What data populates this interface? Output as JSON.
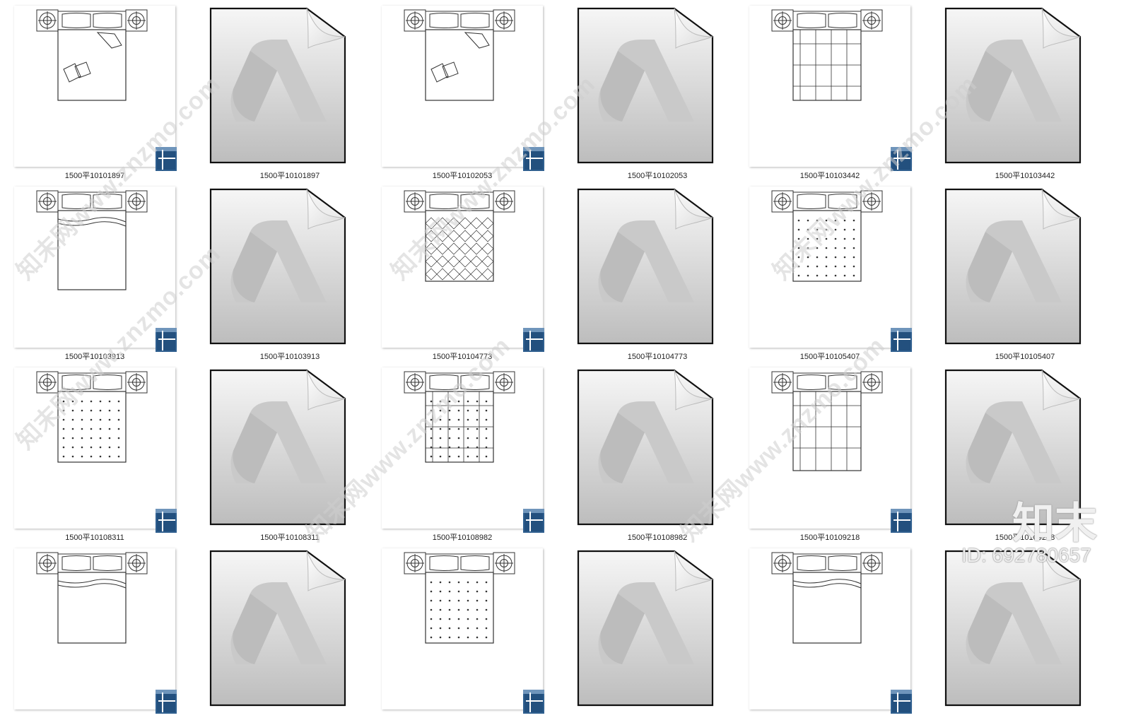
{
  "view": {
    "name": "file-thumbnail-view"
  },
  "rows": [
    {
      "items": [
        {
          "kind": "dwg",
          "label": "1500平10101897",
          "variant": 1
        },
        {
          "kind": "doc",
          "label": "1500平10101897"
        },
        {
          "kind": "dwg",
          "label": "1500平10102053",
          "variant": 2
        },
        {
          "kind": "doc",
          "label": "1500平10102053"
        },
        {
          "kind": "dwg",
          "label": "1500平10103442",
          "variant": 3
        },
        {
          "kind": "doc",
          "label": "1500平10103442"
        }
      ]
    },
    {
      "items": [
        {
          "kind": "dwg",
          "label": "1500平10103913",
          "variant": 4
        },
        {
          "kind": "doc",
          "label": "1500平10103913"
        },
        {
          "kind": "dwg",
          "label": "1500平10104773",
          "variant": 5
        },
        {
          "kind": "doc",
          "label": "1500平10104773"
        },
        {
          "kind": "dwg",
          "label": "1500平10105407",
          "variant": 6
        },
        {
          "kind": "doc",
          "label": "1500平10105407"
        }
      ]
    },
    {
      "items": [
        {
          "kind": "dwg",
          "label": "1500平10108311",
          "variant": 7
        },
        {
          "kind": "doc",
          "label": "1500平10108311"
        },
        {
          "kind": "dwg",
          "label": "1500平10108982",
          "variant": 8
        },
        {
          "kind": "doc",
          "label": "1500平10108982"
        },
        {
          "kind": "dwg",
          "label": "1500平10109218",
          "variant": 9
        },
        {
          "kind": "doc",
          "label": "1500平10109218"
        }
      ]
    },
    {
      "items": [
        {
          "kind": "dwg",
          "label": "",
          "variant": 10
        },
        {
          "kind": "doc",
          "label": ""
        },
        {
          "kind": "dwg",
          "label": "",
          "variant": 11
        },
        {
          "kind": "doc",
          "label": ""
        },
        {
          "kind": "dwg",
          "label": "",
          "variant": 12
        },
        {
          "kind": "doc",
          "label": ""
        }
      ]
    }
  ],
  "icons": {
    "dwg_thumb": "dwg-bed-plan-thumbnail",
    "doc_thumb": "autodesk-document-icon",
    "badge": "dwg-file-badge-icon"
  },
  "watermark": {
    "text": "知末网www.znzmo.com",
    "brand": "知末",
    "id": "ID: 692780657"
  },
  "colors": {
    "doc_gradient_top": "#f4f4f4",
    "doc_gradient_bottom": "#bfbfbf",
    "badge_blue": "#2f5f8f",
    "line": "#333333"
  }
}
